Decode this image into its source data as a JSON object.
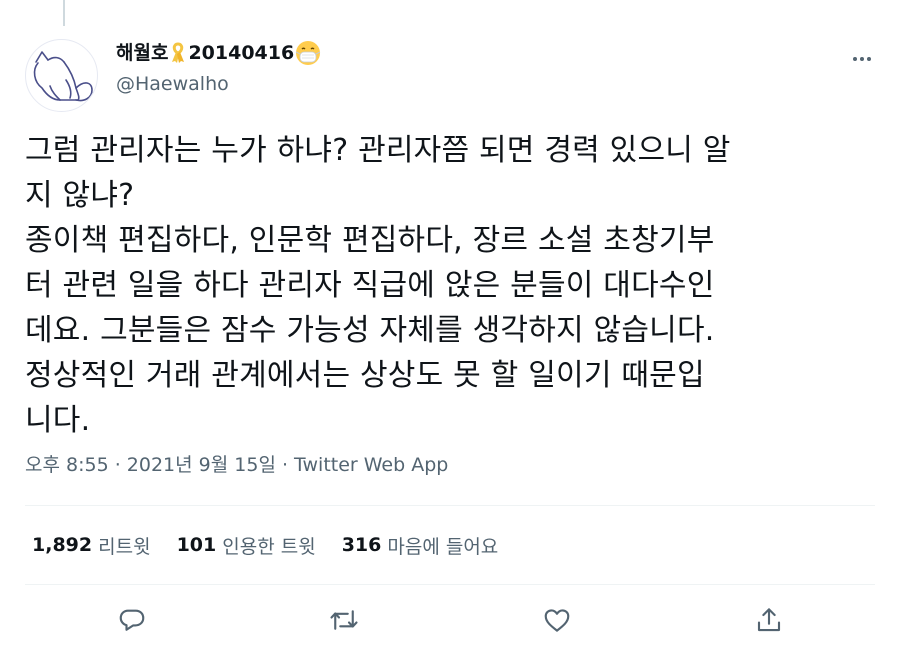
{
  "tweet": {
    "author": {
      "display_name": "해월호",
      "display_suffix": "20140416",
      "handle": "@Haewalho"
    },
    "text_lines": [
      "그럼 관리자는 누가 하냐? 관리자쯤 되면 경력 있으니 알",
      "지 않냐?",
      "종이책 편집하다, 인문학 편집하다, 장르 소설 초창기부",
      "터 관련 일을 하다 관리자 직급에 앉은 분들이 대다수인",
      "데요. 그분들은 잠수 가능성 자체를 생각하지 않습니다.",
      "정상적인 거래 관계에서는 상상도 못 할 일이기 때문입",
      "니다."
    ],
    "timestamp": "오후 8:55 · 2021년 9월 15일 · Twitter Web App",
    "stats": {
      "retweets_count": "1,892",
      "retweets_label": "리트윗",
      "quotes_count": "101",
      "quotes_label": "인용한 트윗",
      "likes_count": "316",
      "likes_label": "마음에 들어요"
    }
  },
  "icons": {
    "more": "more-horizontal-icon",
    "reply": "reply-icon",
    "retweet": "retweet-icon",
    "like": "heart-icon",
    "share": "share-icon",
    "ribbon": "yellow-ribbon-icon",
    "mask": "face-with-mask-emoji"
  },
  "colors": {
    "text_primary": "#0f1419",
    "text_secondary": "#536471",
    "divider": "#eff3f4",
    "ribbon": "#f4c542",
    "avatar_stroke": "#4a4f8a"
  }
}
